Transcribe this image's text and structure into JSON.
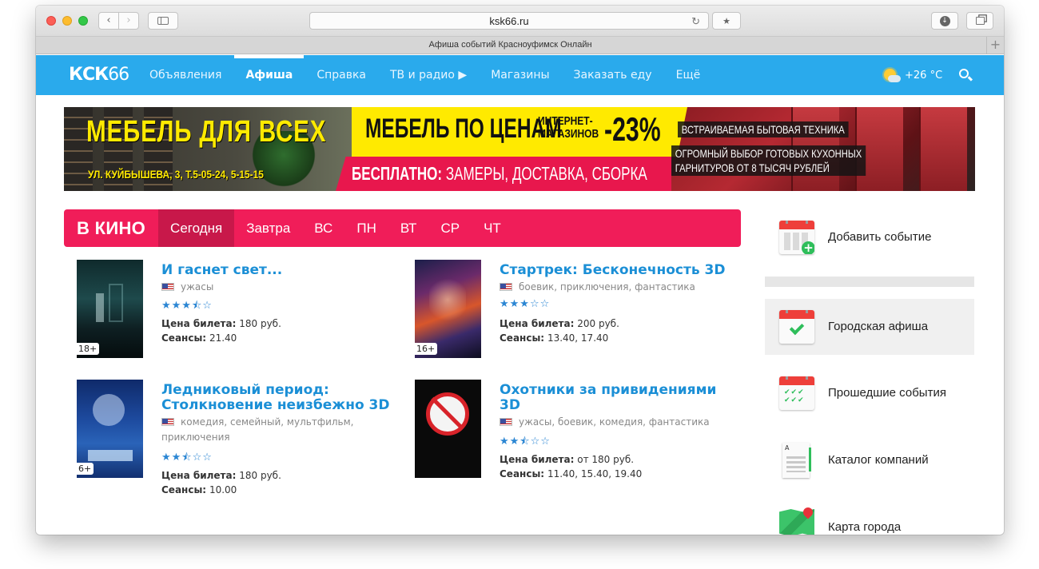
{
  "browser": {
    "url": "ksk66.ru",
    "tab_title": "Афиша событий Красноуфимск Онлайн",
    "tab_add": "+",
    "nav_back": "‹",
    "nav_forward": "›",
    "reload": "↻",
    "bookmark": "★",
    "download": "↓"
  },
  "header": {
    "logo_bold": "КСК",
    "logo_num": "66",
    "nav": [
      {
        "label": "Объявления"
      },
      {
        "label": "Афиша",
        "active": true
      },
      {
        "label": "Справка"
      },
      {
        "label": "ТВ и радио ▶"
      },
      {
        "label": "Магазины"
      },
      {
        "label": "Заказать еду"
      },
      {
        "label": "Ещё"
      }
    ],
    "weather": "+26 °C",
    "accent_color": "#2aaaec"
  },
  "banner": {
    "title": "МЕБЕЛЬ ДЛЯ ВСЕХ",
    "address": "УЛ. КУЙБЫШЕВА, 3, Т.5-05-24, 5-15-15",
    "price_text": "МЕБЕЛЬ ПО ЦЕНАМ",
    "internet_line1": "ИНТЕРНЕТ-",
    "internet_line2": "МАГАЗИНОВ",
    "discount": "-23%",
    "free_bold": "БЕСПЛАТНО:",
    "free_rest": " ЗАМЕРЫ, ДОСТАВКА, СБОРКА",
    "tag1": "ВСТРАИВАЕМАЯ БЫТОВАЯ ТЕХНИКА",
    "tag2_line1": "ОГРОМНЫЙ ВЫБОР ГОТОВЫХ КУХОННЫХ",
    "tag2_line2": "ГАРНИТУРОВ ОТ 8 ТЫСЯЧ РУБЛЕЙ"
  },
  "cinema": {
    "title": "В КИНО",
    "accent_color": "#f01d59",
    "days": [
      {
        "label": "Сегодня",
        "active": true
      },
      {
        "label": "Завтра"
      },
      {
        "label": "ВС"
      },
      {
        "label": "ПН"
      },
      {
        "label": "ВТ"
      },
      {
        "label": "СР"
      },
      {
        "label": "ЧТ"
      }
    ],
    "price_label": "Цена билета:",
    "sessions_label": "Сеансы:",
    "movies": [
      {
        "title": "И гаснет свет...",
        "genres": "ужасы",
        "rating": 3.5,
        "stars": "★★★⯪☆",
        "price": "180 руб.",
        "sessions": "21.40",
        "age": "18+"
      },
      {
        "title": "Стартрек: Бесконечность 3D",
        "genres": "боевик,  приключения,  фантастика",
        "rating": 3,
        "stars": "★★★☆☆",
        "price": "200 руб.",
        "sessions": "13.40, 17.40",
        "age": "16+"
      },
      {
        "title": "Ледниковый период: Столкновение неизбежно 3D",
        "genres": "комедия,  семейный,  мультфильм,  приключения",
        "rating": 2.5,
        "stars": "★★⯪☆☆",
        "price": "180 руб.",
        "sessions": "10.00",
        "age": "6+"
      },
      {
        "title": "Охотники за привидениями 3D",
        "genres": "ужасы,  боевик,  комедия,  фантастика",
        "rating": 2.5,
        "stars": "★★⯪☆☆",
        "price": "от 180 руб.",
        "sessions": "11.40, 15.40, 19.40",
        "age": ""
      }
    ]
  },
  "sidebar": {
    "items": [
      {
        "label": "Добавить событие",
        "icon": "calendar-add-icon"
      },
      {
        "label": "Городская афиша",
        "icon": "calendar-check-icon",
        "active": true
      },
      {
        "label": "Прошедшие события",
        "icon": "calendar-done-icon"
      },
      {
        "label": "Каталог компаний",
        "icon": "catalog-icon"
      },
      {
        "label": "Карта города",
        "icon": "map-icon"
      }
    ]
  }
}
